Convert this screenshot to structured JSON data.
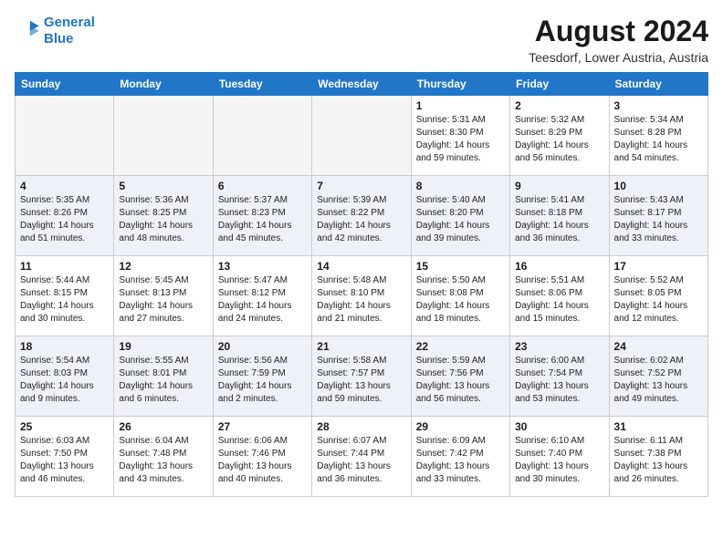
{
  "header": {
    "logo_line1": "General",
    "logo_line2": "Blue",
    "month_year": "August 2024",
    "location": "Teesdorf, Lower Austria, Austria"
  },
  "weekdays": [
    "Sunday",
    "Monday",
    "Tuesday",
    "Wednesday",
    "Thursday",
    "Friday",
    "Saturday"
  ],
  "weeks": [
    [
      {
        "day": "",
        "info": ""
      },
      {
        "day": "",
        "info": ""
      },
      {
        "day": "",
        "info": ""
      },
      {
        "day": "",
        "info": ""
      },
      {
        "day": "1",
        "info": "Sunrise: 5:31 AM\nSunset: 8:30 PM\nDaylight: 14 hours\nand 59 minutes."
      },
      {
        "day": "2",
        "info": "Sunrise: 5:32 AM\nSunset: 8:29 PM\nDaylight: 14 hours\nand 56 minutes."
      },
      {
        "day": "3",
        "info": "Sunrise: 5:34 AM\nSunset: 8:28 PM\nDaylight: 14 hours\nand 54 minutes."
      }
    ],
    [
      {
        "day": "4",
        "info": "Sunrise: 5:35 AM\nSunset: 8:26 PM\nDaylight: 14 hours\nand 51 minutes."
      },
      {
        "day": "5",
        "info": "Sunrise: 5:36 AM\nSunset: 8:25 PM\nDaylight: 14 hours\nand 48 minutes."
      },
      {
        "day": "6",
        "info": "Sunrise: 5:37 AM\nSunset: 8:23 PM\nDaylight: 14 hours\nand 45 minutes."
      },
      {
        "day": "7",
        "info": "Sunrise: 5:39 AM\nSunset: 8:22 PM\nDaylight: 14 hours\nand 42 minutes."
      },
      {
        "day": "8",
        "info": "Sunrise: 5:40 AM\nSunset: 8:20 PM\nDaylight: 14 hours\nand 39 minutes."
      },
      {
        "day": "9",
        "info": "Sunrise: 5:41 AM\nSunset: 8:18 PM\nDaylight: 14 hours\nand 36 minutes."
      },
      {
        "day": "10",
        "info": "Sunrise: 5:43 AM\nSunset: 8:17 PM\nDaylight: 14 hours\nand 33 minutes."
      }
    ],
    [
      {
        "day": "11",
        "info": "Sunrise: 5:44 AM\nSunset: 8:15 PM\nDaylight: 14 hours\nand 30 minutes."
      },
      {
        "day": "12",
        "info": "Sunrise: 5:45 AM\nSunset: 8:13 PM\nDaylight: 14 hours\nand 27 minutes."
      },
      {
        "day": "13",
        "info": "Sunrise: 5:47 AM\nSunset: 8:12 PM\nDaylight: 14 hours\nand 24 minutes."
      },
      {
        "day": "14",
        "info": "Sunrise: 5:48 AM\nSunset: 8:10 PM\nDaylight: 14 hours\nand 21 minutes."
      },
      {
        "day": "15",
        "info": "Sunrise: 5:50 AM\nSunset: 8:08 PM\nDaylight: 14 hours\nand 18 minutes."
      },
      {
        "day": "16",
        "info": "Sunrise: 5:51 AM\nSunset: 8:06 PM\nDaylight: 14 hours\nand 15 minutes."
      },
      {
        "day": "17",
        "info": "Sunrise: 5:52 AM\nSunset: 8:05 PM\nDaylight: 14 hours\nand 12 minutes."
      }
    ],
    [
      {
        "day": "18",
        "info": "Sunrise: 5:54 AM\nSunset: 8:03 PM\nDaylight: 14 hours\nand 9 minutes."
      },
      {
        "day": "19",
        "info": "Sunrise: 5:55 AM\nSunset: 8:01 PM\nDaylight: 14 hours\nand 6 minutes."
      },
      {
        "day": "20",
        "info": "Sunrise: 5:56 AM\nSunset: 7:59 PM\nDaylight: 14 hours\nand 2 minutes."
      },
      {
        "day": "21",
        "info": "Sunrise: 5:58 AM\nSunset: 7:57 PM\nDaylight: 13 hours\nand 59 minutes."
      },
      {
        "day": "22",
        "info": "Sunrise: 5:59 AM\nSunset: 7:56 PM\nDaylight: 13 hours\nand 56 minutes."
      },
      {
        "day": "23",
        "info": "Sunrise: 6:00 AM\nSunset: 7:54 PM\nDaylight: 13 hours\nand 53 minutes."
      },
      {
        "day": "24",
        "info": "Sunrise: 6:02 AM\nSunset: 7:52 PM\nDaylight: 13 hours\nand 49 minutes."
      }
    ],
    [
      {
        "day": "25",
        "info": "Sunrise: 6:03 AM\nSunset: 7:50 PM\nDaylight: 13 hours\nand 46 minutes."
      },
      {
        "day": "26",
        "info": "Sunrise: 6:04 AM\nSunset: 7:48 PM\nDaylight: 13 hours\nand 43 minutes."
      },
      {
        "day": "27",
        "info": "Sunrise: 6:06 AM\nSunset: 7:46 PM\nDaylight: 13 hours\nand 40 minutes."
      },
      {
        "day": "28",
        "info": "Sunrise: 6:07 AM\nSunset: 7:44 PM\nDaylight: 13 hours\nand 36 minutes."
      },
      {
        "day": "29",
        "info": "Sunrise: 6:09 AM\nSunset: 7:42 PM\nDaylight: 13 hours\nand 33 minutes."
      },
      {
        "day": "30",
        "info": "Sunrise: 6:10 AM\nSunset: 7:40 PM\nDaylight: 13 hours\nand 30 minutes."
      },
      {
        "day": "31",
        "info": "Sunrise: 6:11 AM\nSunset: 7:38 PM\nDaylight: 13 hours\nand 26 minutes."
      }
    ]
  ]
}
